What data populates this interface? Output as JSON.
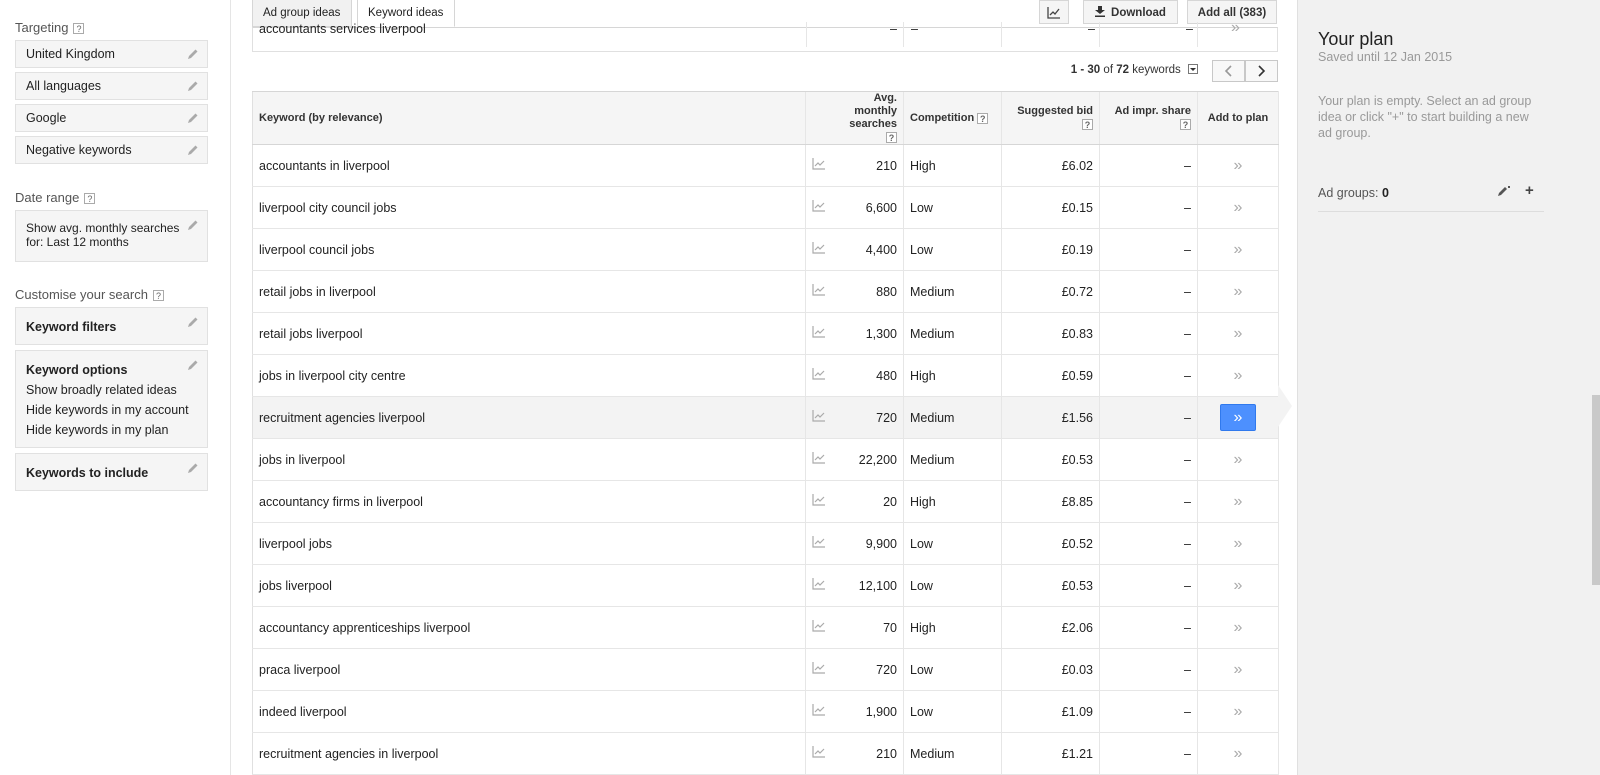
{
  "sidebar": {
    "targeting_title": "Targeting",
    "targeting_items": [
      "United Kingdom",
      "All languages",
      "Google",
      "Negative keywords"
    ],
    "date_title": "Date range",
    "date_text_line1": "Show avg. monthly searches",
    "date_text_line2": "for: Last 12 months",
    "customise_title": "Customise your search",
    "keyword_filters": "Keyword filters",
    "keyword_options": {
      "title": "Keyword options",
      "items": [
        "Show broadly related ideas",
        "Hide keywords in my account",
        "Hide keywords in my plan"
      ]
    },
    "keywords_include": "Keywords to include",
    "help_glyph": "?"
  },
  "toolbar": {
    "tabs": [
      "Ad group ideas",
      "Keyword ideas"
    ],
    "active_tab": "Keyword ideas",
    "download_label": "Download",
    "add_all_label": "Add all (383)"
  },
  "prev_row": {
    "keyword": "accountants services liverpool",
    "volume": "–",
    "competition": "–",
    "bid": "–",
    "impr": "–"
  },
  "pager": {
    "range": "1 - 30",
    "of_label": "of",
    "total": "72",
    "unit": "keywords"
  },
  "table": {
    "headers": {
      "keyword": "Keyword (by relevance)",
      "volume_line1": "Avg. monthly",
      "volume_line2": "searches",
      "competition": "Competition",
      "bid": "Suggested bid",
      "impr": "Ad impr. share",
      "add": "Add to plan"
    },
    "add_glyph": "»",
    "rows": [
      {
        "keyword": "accountants in liverpool",
        "volume": "210",
        "competition": "High",
        "bid": "£6.02",
        "impr": "–"
      },
      {
        "keyword": "liverpool city council jobs",
        "volume": "6,600",
        "competition": "Low",
        "bid": "£0.15",
        "impr": "–"
      },
      {
        "keyword": "liverpool council jobs",
        "volume": "4,400",
        "competition": "Low",
        "bid": "£0.19",
        "impr": "–"
      },
      {
        "keyword": "retail jobs in liverpool",
        "volume": "880",
        "competition": "Medium",
        "bid": "£0.72",
        "impr": "–"
      },
      {
        "keyword": "retail jobs liverpool",
        "volume": "1,300",
        "competition": "Medium",
        "bid": "£0.83",
        "impr": "–"
      },
      {
        "keyword": "jobs in liverpool city centre",
        "volume": "480",
        "competition": "High",
        "bid": "£0.59",
        "impr": "–"
      },
      {
        "keyword": "recruitment agencies liverpool",
        "volume": "720",
        "competition": "Medium",
        "bid": "£1.56",
        "impr": "–",
        "highlighted": true
      },
      {
        "keyword": "jobs in liverpool",
        "volume": "22,200",
        "competition": "Medium",
        "bid": "£0.53",
        "impr": "–"
      },
      {
        "keyword": "accountancy firms in liverpool",
        "volume": "20",
        "competition": "High",
        "bid": "£8.85",
        "impr": "–"
      },
      {
        "keyword": "liverpool jobs",
        "volume": "9,900",
        "competition": "Low",
        "bid": "£0.52",
        "impr": "–"
      },
      {
        "keyword": "jobs liverpool",
        "volume": "12,100",
        "competition": "Low",
        "bid": "£0.53",
        "impr": "–"
      },
      {
        "keyword": "accountancy apprenticeships liverpool",
        "volume": "70",
        "competition": "High",
        "bid": "£2.06",
        "impr": "–"
      },
      {
        "keyword": "praca liverpool",
        "volume": "720",
        "competition": "Low",
        "bid": "£0.03",
        "impr": "–"
      },
      {
        "keyword": "indeed liverpool",
        "volume": "1,900",
        "competition": "Low",
        "bid": "£1.09",
        "impr": "–"
      },
      {
        "keyword": "recruitment agencies in liverpool",
        "volume": "210",
        "competition": "Medium",
        "bid": "£1.21",
        "impr": "–"
      }
    ]
  },
  "plan": {
    "title": "Your plan",
    "saved": "Saved until 12 Jan 2015",
    "empty_text": "Your plan is empty. Select an ad group idea or click \"+\" to start building a new ad group.",
    "ad_groups_label": "Ad groups:",
    "ad_groups_count": "0",
    "plus_glyph": "+"
  },
  "icons": [
    "pencil-icon",
    "chart-icon",
    "download-icon",
    "chevron-left-icon",
    "chevron-right-icon",
    "dropdown-icon",
    "trend-icon"
  ],
  "colors": {
    "accent_blue": "#4d90fe",
    "panel_bg": "#f1f1f1"
  }
}
